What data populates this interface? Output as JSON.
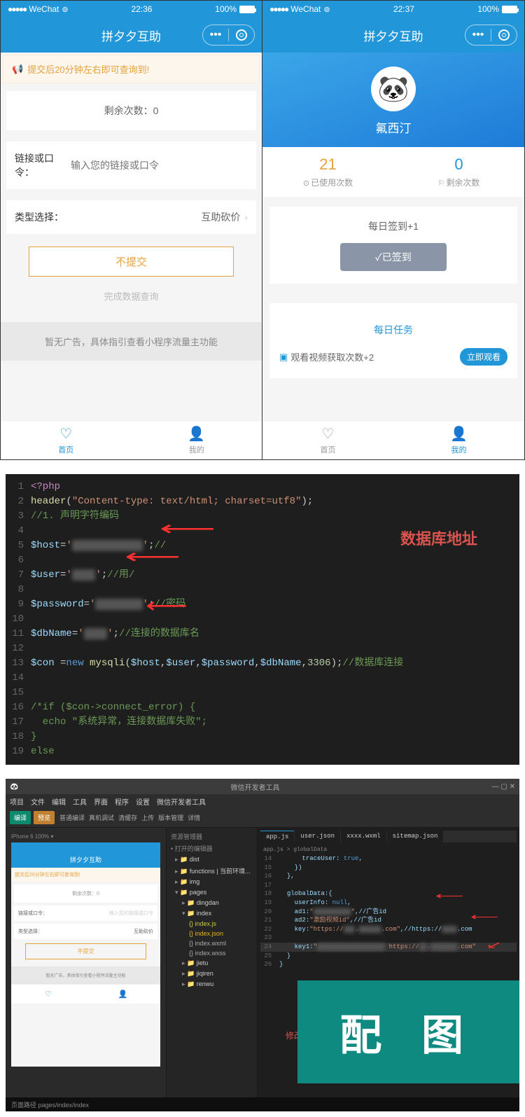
{
  "phone1": {
    "status": {
      "carrier": "WeChat",
      "time": "22:36",
      "battery": "100%"
    },
    "nav_title": "拼夕夕互助",
    "notice": "提交后20分钟左右即可查询到!",
    "remain_label": "剩余次数：0",
    "link_label": "链接或口令：",
    "link_placeholder": "输入您的链接或口令",
    "type_label": "类型选择：",
    "type_value": "互助砍价",
    "submit": "不提交",
    "query_link": "完成数据查询",
    "ad_text": "暂无广告，具体指引查看小程序流量主功能",
    "tab_home": "首页",
    "tab_me": "我的"
  },
  "phone2": {
    "status": {
      "carrier": "WeChat",
      "time": "22:37",
      "battery": "100%"
    },
    "nav_title": "拼夕夕互助",
    "username": "氟西汀",
    "used_num": "21",
    "used_label": "已使用次数",
    "remain_num": "0",
    "remain_label": "剩余次数",
    "signin_title": "每日签到+1",
    "signed_btn": "✓已签到",
    "daily_task": "每日任务",
    "task_text": "观看视频获取次数+2",
    "watch_btn": "立即观看",
    "tab_home": "首页",
    "tab_me": "我的"
  },
  "code": {
    "label": "数据库地址",
    "lines": [
      {
        "n": "1",
        "html": "<span class='c-red'>&lt;?php</span>"
      },
      {
        "n": "2",
        "html": "<span class='c-fn'>header</span>(<span class='c-str'>\"Content-type: text/html; charset=utf8\"</span>);"
      },
      {
        "n": "3",
        "html": "<span class='c-cmt'>//1. 声明字符编码</span>"
      },
      {
        "n": "4",
        "html": ""
      },
      {
        "n": "5",
        "html": "<span class='c-var'>$host</span>=<span class='c-str'>'<span class='blur'>████████████</span>'</span>;<span class='c-cmt'>//</span>"
      },
      {
        "n": "6",
        "html": ""
      },
      {
        "n": "7",
        "html": "<span class='c-var'>$user</span>=<span class='c-str'>'<span class='blur'>████</span>'</span>;<span class='c-cmt'>//用/</span>"
      },
      {
        "n": "8",
        "html": ""
      },
      {
        "n": "9",
        "html": "<span class='c-var'>$password</span>=<span class='c-str'>'<span class='blur'>████████</span>'</span>;<span class='c-cmt'>//密码</span>"
      },
      {
        "n": "10",
        "html": ""
      },
      {
        "n": "11",
        "html": "<span class='c-var'>$dbName</span>=<span class='c-str'>'<span class='blur'>████</span>'</span>;<span class='c-cmt'>//连接的数据库名</span>"
      },
      {
        "n": "12",
        "html": ""
      },
      {
        "n": "13",
        "html": "<span class='c-var'>$con</span> =<span class='c-blue'>new</span> <span class='c-fn'>mysqli</span>(<span class='c-var'>$host</span>,<span class='c-var'>$user</span>,<span class='c-var'>$password</span>,<span class='c-var'>$dbName</span>,<span class='c-num'>3306</span>);<span class='c-cmt'>//数据库连接</span>"
      },
      {
        "n": "14",
        "html": ""
      },
      {
        "n": "15",
        "html": ""
      },
      {
        "n": "16",
        "html": "<span class='c-cmt'>/*if ($con-&gt;connect_error) {</span>"
      },
      {
        "n": "17",
        "html": "<span class='c-cmt'>  echo \"系统异常，连接数据库失败\";</span>"
      },
      {
        "n": "18",
        "html": "<span class='c-cmt'>}</span>"
      },
      {
        "n": "19",
        "html": "<span class='c-cmt'>else</span>"
      }
    ]
  },
  "ide": {
    "title": "微信开发者工具",
    "menus": [
      "项目",
      "文件",
      "编辑",
      "工具",
      "界面",
      "程序",
      "设置",
      "微信开发者工具"
    ],
    "toolbar": {
      "compile": "编译",
      "preview": "预览",
      "other": [
        "普通编译",
        "真机调试",
        "清缓存",
        "上传",
        "版本管理",
        "详情"
      ]
    },
    "tree_header": "资源管理器",
    "tree_sub": "• 打开的编辑器",
    "tree": [
      {
        "t": "folder",
        "name": "dist"
      },
      {
        "t": "folder",
        "name": "functions",
        "suffix": " | 当前环境..."
      },
      {
        "t": "folder",
        "name": "img"
      },
      {
        "t": "folder",
        "name": "pages",
        "open": true
      },
      {
        "t": "folder",
        "name": "dingdan",
        "indent": 1
      },
      {
        "t": "folder",
        "name": "index",
        "indent": 1,
        "open": true
      },
      {
        "t": "file",
        "name": "index.js",
        "cls": "js",
        "indent": 2
      },
      {
        "t": "file",
        "name": "index.json",
        "cls": "json",
        "indent": 2
      },
      {
        "t": "file",
        "name": "index.wxml",
        "indent": 2
      },
      {
        "t": "file",
        "name": "index.wxss",
        "indent": 2
      },
      {
        "t": "folder",
        "name": "jietu",
        "indent": 1
      },
      {
        "t": "folder",
        "name": "jiqiren",
        "indent": 1
      },
      {
        "t": "folder",
        "name": "renwu",
        "indent": 1
      }
    ],
    "editor_tabs": [
      "app.js",
      "user.json",
      "xxxx.wxml",
      "sitemap.json"
    ],
    "editor_crumb": "app.js > globalData",
    "editor_lines": [
      "      traceUser: true,",
      "    })",
      "  },",
      "",
      "  globalData:{",
      "    userInfo: null,",
      "    ad1:\"██████████\",//广告id",
      "    ad2:\"激励视频id\",//广告id",
      "    key:\"https://███.██████.com\",//https://████.com",
      "",
      "    key1:\"██████████████████ https://██.███████.com\"",
      "  }",
      "}"
    ],
    "highlight_line": 10,
    "modify_label": "修改配置",
    "statusbar": "页面路径  pages/index/index",
    "overlay": "配 图"
  }
}
